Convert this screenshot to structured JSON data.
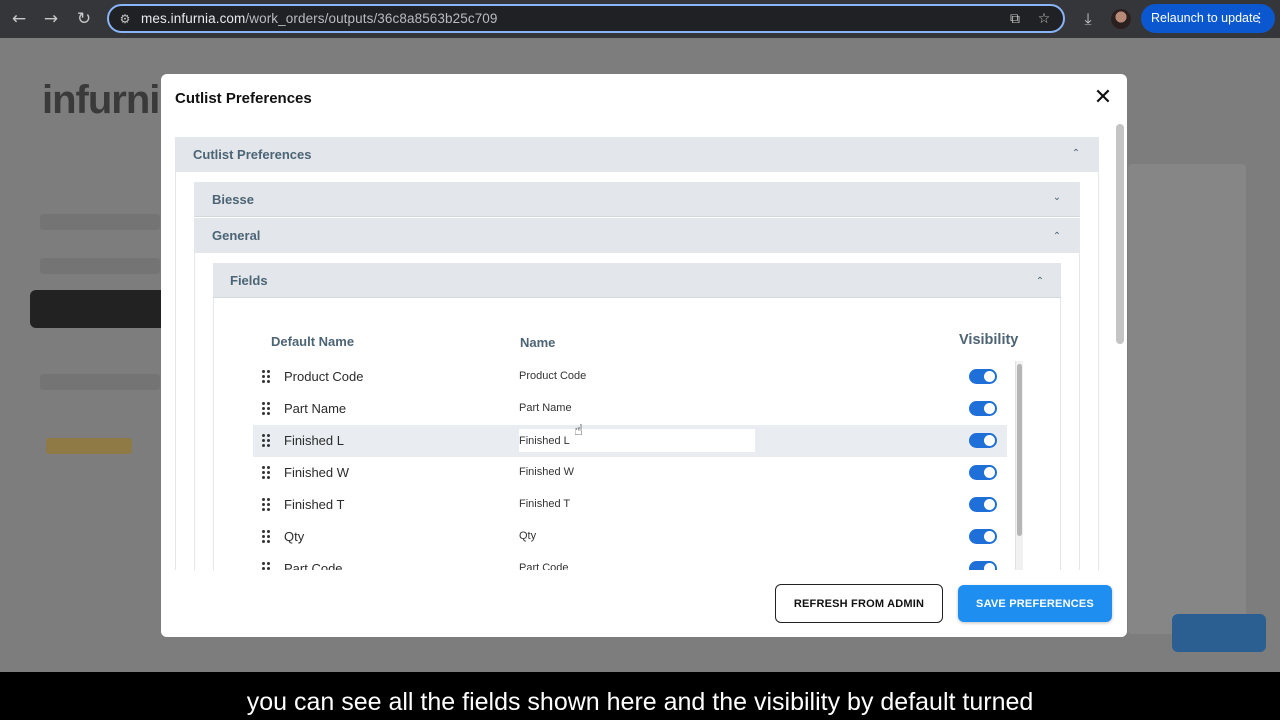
{
  "browser": {
    "url_host": "mes.infurnia.com",
    "url_path": "/work_orders/outputs/36c8a8563b25c709",
    "relaunch_label": "Relaunch to update",
    "icons": [
      "back-icon",
      "forward-icon",
      "reload-icon",
      "site-info-icon",
      "install-icon",
      "bookmark-star-icon",
      "download-icon",
      "profile-avatar",
      "more-icon"
    ]
  },
  "page": {
    "logo_text": "infurni"
  },
  "modal": {
    "title": "Cutlist Preferences",
    "close_glyph": "✕",
    "outer_accordion": {
      "label": "Cutlist Preferences"
    },
    "sections": [
      {
        "label": "Biesse",
        "expanded": false
      },
      {
        "label": "General",
        "expanded": true
      }
    ],
    "fields_section": {
      "label": "Fields"
    },
    "columns": {
      "default_name": "Default Name",
      "name": "Name",
      "visibility": "Visibility"
    },
    "rows": [
      {
        "default_name": "Product Code",
        "name": "Product Code",
        "visible": true
      },
      {
        "default_name": "Part Name",
        "name": "Part Name",
        "visible": true
      },
      {
        "default_name": "Finished L",
        "name": "Finished L",
        "visible": true,
        "editing": true
      },
      {
        "default_name": "Finished W",
        "name": "Finished W",
        "visible": true
      },
      {
        "default_name": "Finished T",
        "name": "Finished T",
        "visible": true
      },
      {
        "default_name": "Qty",
        "name": "Qty",
        "visible": true
      },
      {
        "default_name": "Part Code",
        "name": "Part Code",
        "visible": true
      }
    ],
    "buttons": {
      "refresh": "REFRESH FROM ADMIN",
      "save": "SAVE PREFERENCES"
    }
  },
  "caption": "you can see all the fields shown here and the visibility by default turned",
  "colors": {
    "accent": "#1f8ef1",
    "toggle_on": "#1f6fd8",
    "section_header": "#e3e7eb",
    "section_text": "#4d6475",
    "chrome_bar": "#35363a",
    "relaunch": "#0b57d0"
  }
}
